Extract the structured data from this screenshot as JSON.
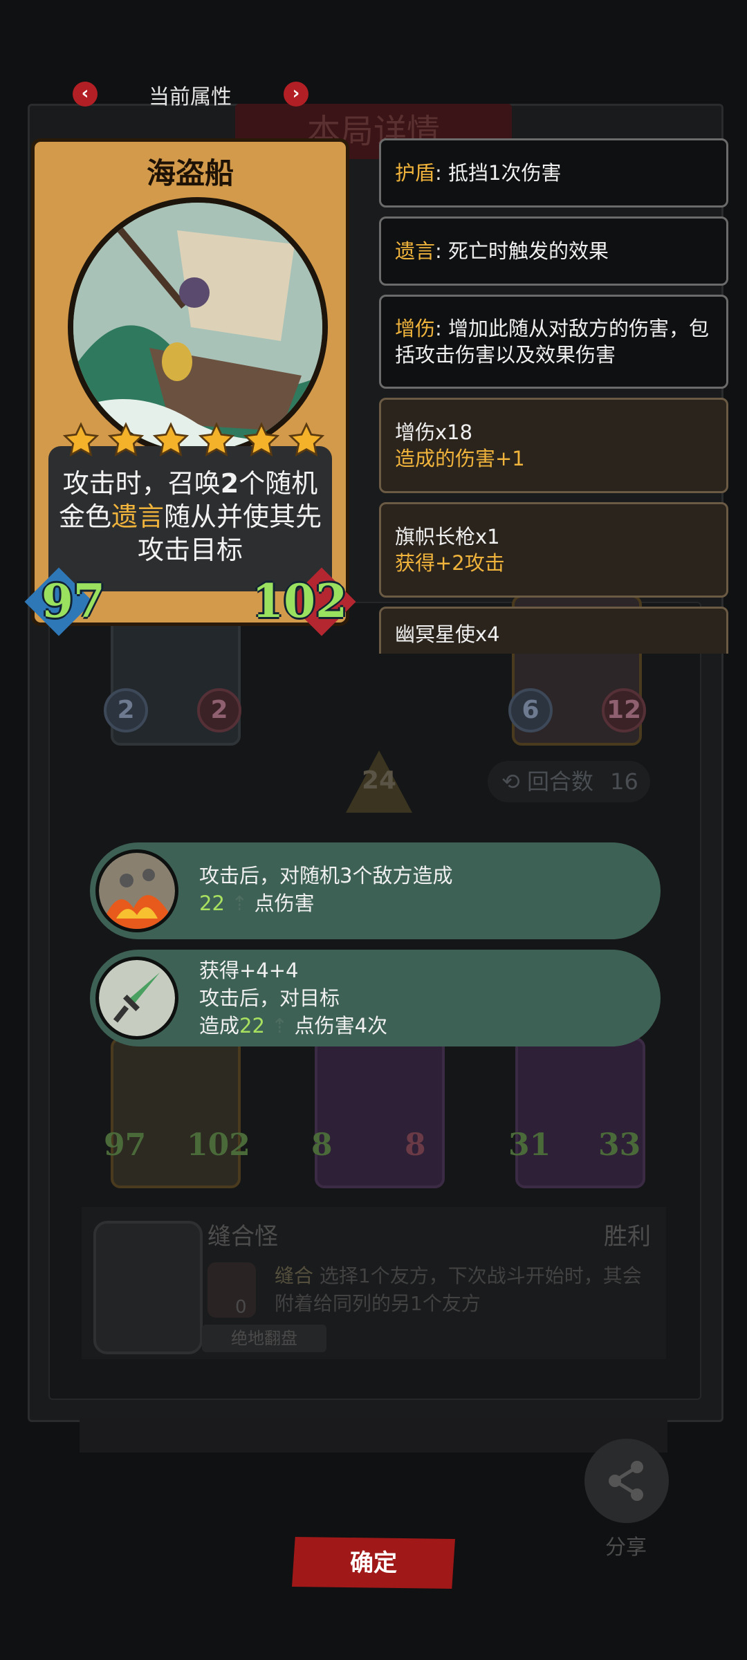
{
  "header": {
    "title": "当前属性",
    "prev_icon": "chevron-left-icon",
    "next_icon": "chevron-right-icon",
    "prev_glyph": "‹",
    "next_glyph": "›"
  },
  "background": {
    "title": "本局详情",
    "round_label": "回合数",
    "round_value": "16",
    "arrow_value": "24",
    "board_top_row": [
      {
        "atk": "2",
        "hp": "2"
      },
      {
        "atk": "6",
        "hp": "12"
      }
    ],
    "board_bottom_row": [
      {
        "atk": "97",
        "hp": "102"
      },
      {
        "atk": "8",
        "hp": "8"
      },
      {
        "atk": "31",
        "hp": "33"
      }
    ],
    "enemy": {
      "name": "缝合怪",
      "result": "胜利",
      "skill_name": "缝合",
      "skill_desc": "选择1个友方，下次战斗开始时，其会附着给同列的另1个友方",
      "tag": "绝地翻盘",
      "counter": "0"
    }
  },
  "card": {
    "name": "海盗船",
    "stars": 6,
    "desc_part1": "攻击时，召唤",
    "desc_num": "2",
    "desc_part2": "个随机金色",
    "desc_keyword": "遗言",
    "desc_part3": "随从并使其先攻击目标",
    "attack": "97",
    "health": "102"
  },
  "info": [
    {
      "keyword": "护盾",
      "text": ": 抵挡1次伤害"
    },
    {
      "keyword": "遗言",
      "text": ": 死亡时触发的效果"
    },
    {
      "keyword": "增伤",
      "text": ": 增加此随从对敌方的伤害，包括攻击伤害以及效果伤害"
    },
    {
      "title": "增伤x18",
      "sub": "造成的伤害+1"
    },
    {
      "title": "旗帜长枪x1",
      "sub": "获得+2攻击"
    },
    {
      "title": "幽冥星使x4",
      "sub": ""
    }
  ],
  "tooltips": [
    {
      "line1": "攻击后，对随机3个敌方造成",
      "num": "22",
      "line2": "点伤害"
    },
    {
      "line1": "获得+4+4",
      "line2": "攻击后，对目标",
      "pre": "造成",
      "num": "22",
      "post": "点伤害4次"
    }
  ],
  "footer": {
    "confirm_label": "确定",
    "share_label": "分享"
  },
  "colors": {
    "accent_red": "#a01818",
    "keyword_gold": "#f0b43c",
    "stat_green": "#9ae160",
    "tooltip_green": "#3e6155"
  }
}
